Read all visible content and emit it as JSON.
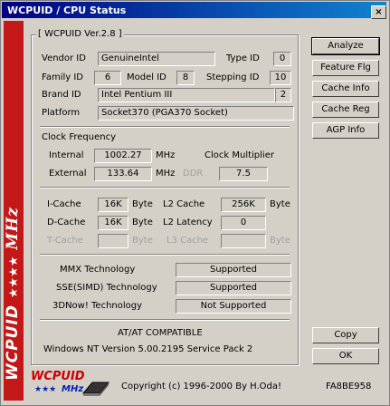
{
  "window": {
    "title": "WCPUID / CPU Status",
    "close_glyph": "×"
  },
  "sidebar": {
    "brand": "WCPUID",
    "stars": "★★★★",
    "unit": "MHz"
  },
  "group": {
    "title": "[ WCPUID Ver.2.8 ]"
  },
  "cpu": {
    "vendor_id_label": "Vendor ID",
    "vendor_id": "GenuineIntel",
    "type_id_label": "Type ID",
    "type_id": "0",
    "family_id_label": "Family ID",
    "family_id": "6",
    "model_id_label": "Model ID",
    "model_id": "8",
    "stepping_id_label": "Stepping ID",
    "stepping_id": "10",
    "brand_id_label": "Brand ID",
    "brand_id": "Intel Pentium III",
    "brand_num": "2",
    "platform_label": "Platform",
    "platform": "Socket370 (PGA370 Socket)"
  },
  "clock": {
    "heading": "Clock Frequency",
    "internal_label": "Internal",
    "internal": "1002.27",
    "internal_unit": "MHz",
    "multiplier_label": "Clock Multiplier",
    "external_label": "External",
    "external": "133.64",
    "external_unit": "MHz",
    "ddr_label": "DDR",
    "multiplier": "7.5"
  },
  "cache": {
    "icache_label": "I-Cache",
    "icache": "16K",
    "icache_unit": "Byte",
    "l2_label": "L2 Cache",
    "l2": "256K",
    "l2_unit": "Byte",
    "dcache_label": "D-Cache",
    "dcache": "16K",
    "dcache_unit": "Byte",
    "l2_latency_label": "L2 Latency",
    "l2_latency": "0",
    "tcache_label": "T-Cache",
    "tcache_unit": "Byte",
    "l3_label": "L3 Cache",
    "l3_unit": "Byte"
  },
  "tech": {
    "mmx_label": "MMX Technology",
    "mmx": "Supported",
    "sse_label": "SSE(SIMD) Technology",
    "sse": "Supported",
    "now_label": "3DNow! Technology",
    "now": "Not Supported"
  },
  "system": {
    "compat": "AT/AT COMPATIBLE",
    "os": "Windows NT  Version 5.00.2195 Service Pack 2"
  },
  "buttons": {
    "analyze": "Analyze",
    "feature": "Feature Flg",
    "cache_info": "Cache Info",
    "cache_reg": "Cache Reg",
    "agp_info": "AGP Info",
    "copy": "Copy",
    "ok": "OK"
  },
  "footer": {
    "logo_text": "WCPUID",
    "logo_sub": "MHz",
    "logo_stars": "★★★",
    "copyright": "Copyright (c) 1996-2000  By H.Oda!",
    "code": "FA8BE958"
  }
}
